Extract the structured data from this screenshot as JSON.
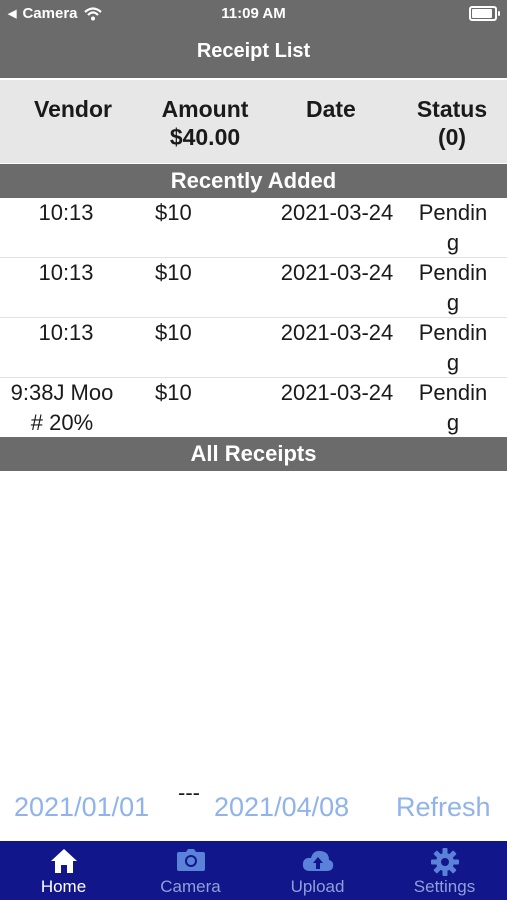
{
  "status_bar": {
    "carrier": "Camera",
    "time": "11:09 AM"
  },
  "header": {
    "title": "Receipt List"
  },
  "columns": {
    "vendor": "Vendor",
    "amount_label": "Amount",
    "amount_total": "$40.00",
    "date": "Date",
    "status_label": "Status",
    "status_count": "(0)"
  },
  "sections": {
    "recent": "Recently Added",
    "all": "All Receipts"
  },
  "recent_rows": [
    {
      "vendor": "10:13",
      "amount": "$10",
      "date": "2021-03-24",
      "status": "Pending"
    },
    {
      "vendor": "10:13",
      "amount": "$10",
      "date": "2021-03-24",
      "status": "Pending"
    },
    {
      "vendor": "10:13",
      "amount": "$10",
      "date": "2021-03-24",
      "status": "Pending"
    },
    {
      "vendor": "9:38J Moo# 20%",
      "amount": "$10",
      "date": "2021-03-24",
      "status": "Pending"
    }
  ],
  "footer": {
    "start_date": "2021/01/01",
    "separator": "---",
    "end_date": "2021/04/08",
    "refresh": "Refresh"
  },
  "tabs": [
    {
      "label": "Home",
      "icon": "home-icon",
      "active": true
    },
    {
      "label": "Camera",
      "icon": "camera-icon",
      "active": false
    },
    {
      "label": "Upload",
      "icon": "cloud-upload-icon",
      "active": false
    },
    {
      "label": "Settings",
      "icon": "gear-icon",
      "active": false
    }
  ],
  "colors": {
    "header_bg": "#6b6b6b",
    "tabbar_bg": "#11168a",
    "link": "#8fb3ea"
  }
}
